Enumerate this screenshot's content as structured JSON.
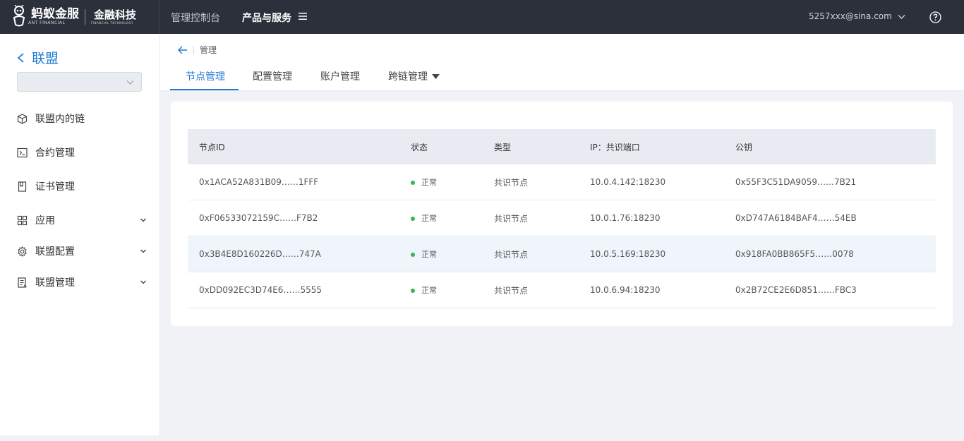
{
  "topbar": {
    "logo_cn": "蚂蚁金服",
    "logo_en": "ANT FINANCIAL",
    "logo_tech_cn": "金融科技",
    "logo_tech_en": "FINANCIAL TECHNOLOGY",
    "nav_console": "管理控制台",
    "nav_products": "产品与服务",
    "user_email": "5257xxx@sina.com"
  },
  "sidebar": {
    "back_label": "联盟",
    "items": [
      {
        "label": "联盟内的链",
        "icon": "cube-icon"
      },
      {
        "label": "合约管理",
        "icon": "terminal-icon"
      },
      {
        "label": "证书管理",
        "icon": "bookmark-icon"
      },
      {
        "label": "应用",
        "icon": "grid-icon"
      },
      {
        "label": "联盟配置",
        "icon": "gear-icon"
      },
      {
        "label": "联盟管理",
        "icon": "document-icon"
      }
    ]
  },
  "breadcrumb": {
    "label": "管理"
  },
  "tabs": [
    {
      "label": "节点管理"
    },
    {
      "label": "配置管理"
    },
    {
      "label": "账户管理"
    },
    {
      "label": "跨链管理"
    }
  ],
  "table": {
    "headers": [
      "节点ID",
      "状态",
      "类型",
      "IP：共识端口",
      "公钥"
    ],
    "rows": [
      {
        "id": "0x1ACA52A831B09……1FFF",
        "status": "正常",
        "type": "共识节点",
        "ip": "10.0.4.142:18230",
        "key": "0x55F3C51DA9059……7B21"
      },
      {
        "id": "0xF06533072159C……F7B2",
        "status": "正常",
        "type": "共识节点",
        "ip": "10.0.1.76:18230",
        "key": "0xD747A6184BAF4……54EB"
      },
      {
        "id": "0x3B4E8D160226D……747A",
        "status": "正常",
        "type": "共识节点",
        "ip": "10.0.5.169:18230",
        "key": "0x918FA0BB865F5……0078"
      },
      {
        "id": "0xDD092EC3D74E6……5555",
        "status": "正常",
        "type": "共识节点",
        "ip": "10.0.6.94:18230",
        "key": "0x2B72CE2E6D851……FBC3"
      }
    ]
  },
  "colors": {
    "accent": "#1f7ad6",
    "topbar": "#2b303b",
    "status_ok": "#34b84a"
  }
}
